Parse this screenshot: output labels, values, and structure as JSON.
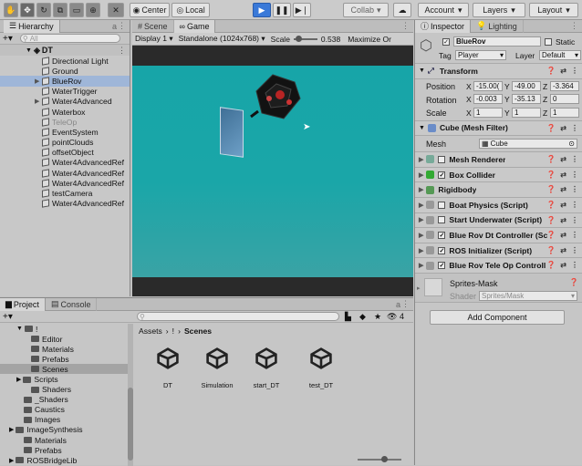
{
  "toolbar": {
    "center": "Center",
    "local": "Local",
    "collab": "Collab",
    "account": "Account",
    "layers": "Layers",
    "layout": "Layout"
  },
  "hierarchy": {
    "tab": "Hierarchy",
    "search_placeholder": "All",
    "scene": "DT",
    "items": [
      {
        "label": "Directional Light",
        "indent": 2,
        "caret": false
      },
      {
        "label": "Ground",
        "indent": 2,
        "caret": false
      },
      {
        "label": "BlueRov",
        "indent": 1,
        "caret": true,
        "selected": true
      },
      {
        "label": "WaterTrigger",
        "indent": 2,
        "caret": false
      },
      {
        "label": "Water4Advanced",
        "indent": 1,
        "caret": true
      },
      {
        "label": "Waterbox",
        "indent": 2,
        "caret": false
      },
      {
        "label": "TeleOp",
        "indent": 2,
        "caret": false,
        "dim": true
      },
      {
        "label": "EventSystem",
        "indent": 2,
        "caret": false
      },
      {
        "label": "pointClouds",
        "indent": 2,
        "caret": false
      },
      {
        "label": "offsetObject",
        "indent": 2,
        "caret": false
      },
      {
        "label": "Water4AdvancedRef",
        "indent": 2,
        "caret": false
      },
      {
        "label": "Water4AdvancedRef",
        "indent": 2,
        "caret": false
      },
      {
        "label": "Water4AdvancedRef",
        "indent": 2,
        "caret": false
      },
      {
        "label": "testCamera",
        "indent": 2,
        "caret": false
      },
      {
        "label": "Water4AdvancedRef",
        "indent": 2,
        "caret": false
      }
    ]
  },
  "game": {
    "tab_scene": "Scene",
    "tab_game": "Game",
    "display": "Display 1",
    "resolution": "Standalone (1024x768)",
    "scale_label": "Scale",
    "scale_value": "0.538",
    "maximize": "Maximize Or"
  },
  "inspector": {
    "tab_inspector": "Inspector",
    "tab_lighting": "Lighting",
    "object_name": "BlueRov",
    "static": "Static",
    "tag_label": "Tag",
    "tag_value": "Player",
    "layer_label": "Layer",
    "layer_value": "Default",
    "transform": {
      "title": "Transform",
      "position_label": "Position",
      "rotation_label": "Rotation",
      "scale_label": "Scale",
      "position": [
        "-15.00(",
        "-49.00",
        "-3.364"
      ],
      "rotation": [
        "-0.003",
        "-35.13",
        "0"
      ],
      "scale": [
        "1",
        "1",
        "1"
      ]
    },
    "mesh_filter": {
      "title": "Cube (Mesh Filter)",
      "mesh_label": "Mesh",
      "mesh_value": "Cube"
    },
    "components": [
      {
        "label": "Mesh Renderer",
        "checked": false
      },
      {
        "label": "Box Collider",
        "checked": true
      },
      {
        "label": "Rigidbody",
        "checked": false,
        "nocheck": true
      },
      {
        "label": "Boat Physics (Script)",
        "checked": false
      },
      {
        "label": "Start Underwater (Script)",
        "checked": false
      },
      {
        "label": "Blue Rov Dt Controller (Sc",
        "checked": true
      },
      {
        "label": "ROS Initializer (Script)",
        "checked": true
      },
      {
        "label": "Blue Rov Tele Op Controll",
        "checked": true
      }
    ],
    "material_name": "Sprites-Mask",
    "shader_label": "Shader",
    "shader_value": "Sprites/Mask",
    "add_component": "Add Component"
  },
  "project": {
    "tab_project": "Project",
    "tab_console": "Console",
    "hidden_count": "4",
    "breadcrumb": [
      "Assets",
      "!",
      "Scenes"
    ],
    "tree_root": "!",
    "tree": [
      {
        "label": "Editor",
        "indent": 2
      },
      {
        "label": "Materials",
        "indent": 2
      },
      {
        "label": "Prefabs",
        "indent": 2
      },
      {
        "label": "Scenes",
        "indent": 2,
        "selected": true
      },
      {
        "label": "Scripts",
        "indent": 1,
        "caret": true
      },
      {
        "label": "Shaders",
        "indent": 2
      },
      {
        "label": "_Shaders",
        "indent": 1
      },
      {
        "label": "Caustics",
        "indent": 1
      },
      {
        "label": "Images",
        "indent": 1
      },
      {
        "label": "ImageSynthesis",
        "indent": 0,
        "caret": true
      },
      {
        "label": "Materials",
        "indent": 1
      },
      {
        "label": "Prefabs",
        "indent": 1
      },
      {
        "label": "ROSBridgeLib",
        "indent": 0,
        "caret": true
      }
    ],
    "assets": [
      "DT",
      "Simulation",
      "start_DT",
      "test_DT"
    ]
  }
}
